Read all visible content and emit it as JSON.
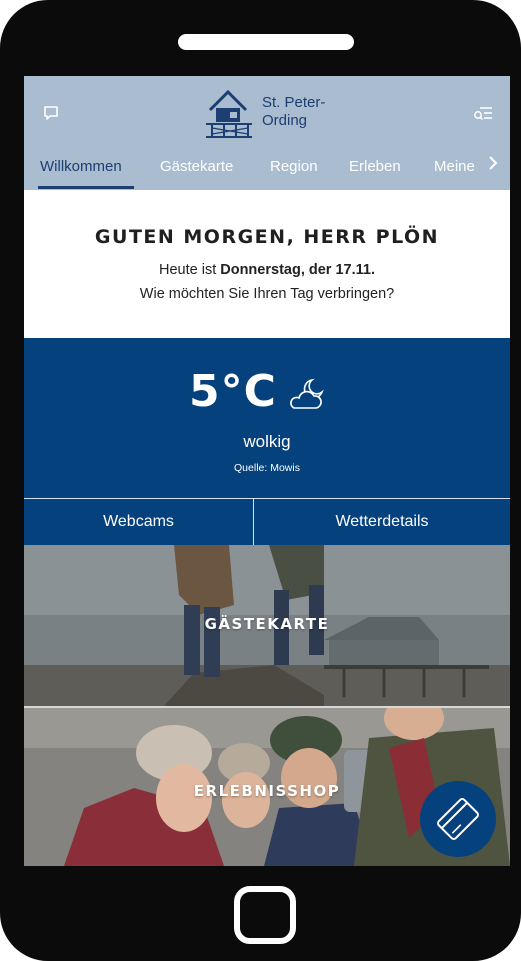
{
  "header": {
    "logo_line1": "St. Peter-",
    "logo_line2": "Ording",
    "icons": [
      "chat-icon",
      "search-menu-icon",
      "logo-house-icon",
      "chevron-right-icon"
    ]
  },
  "tabs": [
    {
      "label": "Willkommen",
      "active": true
    },
    {
      "label": "Gästekarte",
      "active": false
    },
    {
      "label": "Region",
      "active": false
    },
    {
      "label": "Erleben",
      "active": false
    },
    {
      "label": "Meine",
      "active": false
    }
  ],
  "greeting": {
    "title": "GUTEN MORGEN, HERR PLÖN",
    "line1_prefix": "Heute ist ",
    "line1_bold": "Donnerstag, der 17.11.",
    "line2": "Wie möchten Sie Ihren Tag verbringen?"
  },
  "weather": {
    "temperature": "5°C",
    "icon": "moon-cloud-icon",
    "condition": "wolkig",
    "source": "Quelle: Mowis",
    "buttons": {
      "webcams": "Webcams",
      "details": "Wetterdetails"
    }
  },
  "tiles": {
    "guest_card": "GÄSTEKARTE",
    "experience_shop": "ERLEBNISSHOP"
  },
  "fab": {
    "icon": "card-icon"
  },
  "colors": {
    "header_bg": "#a9bcd0",
    "brand_blue": "#05417c",
    "logo_blue": "#1c3e72",
    "phone_frame": "#0b0b0b"
  }
}
